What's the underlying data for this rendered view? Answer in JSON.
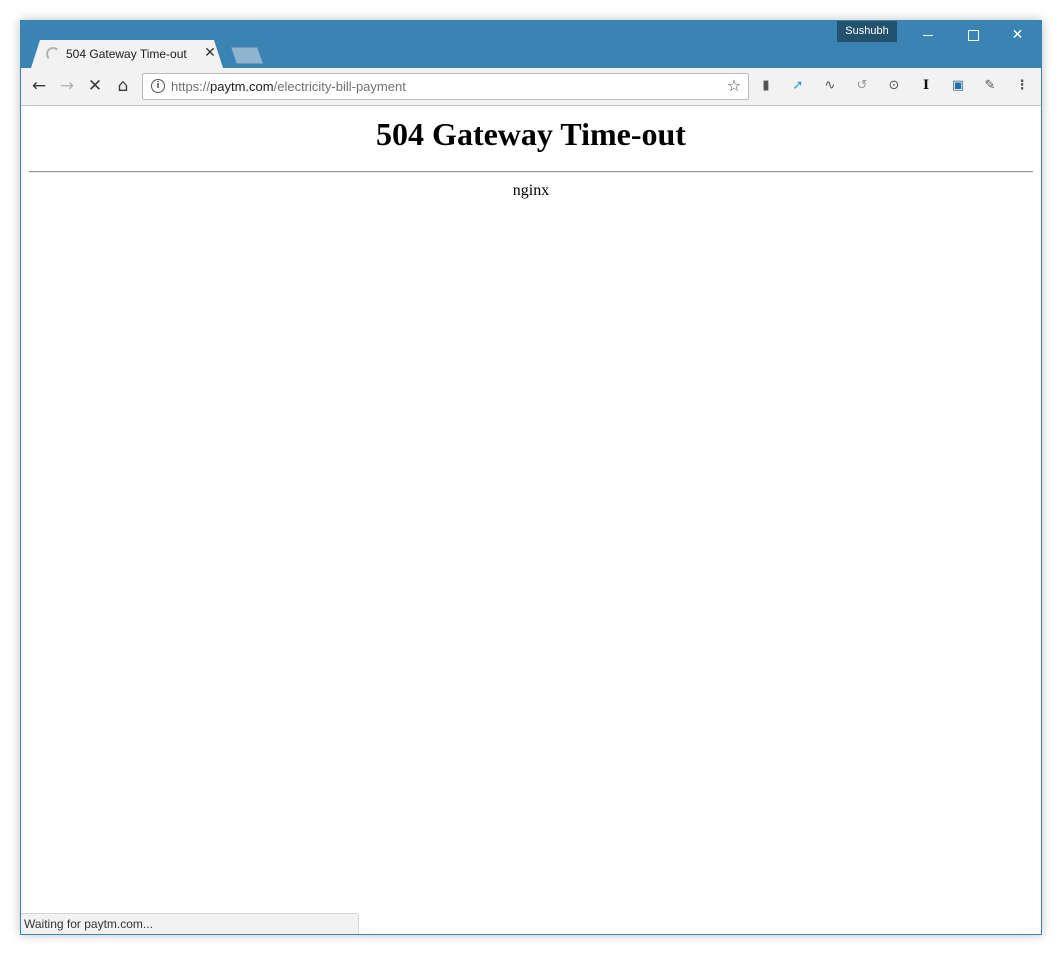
{
  "window": {
    "profile_name": "Sushubh",
    "accent_color": "#3a84b4"
  },
  "tabs": [
    {
      "title": "504 Gateway Time-out",
      "state": "loading"
    }
  ],
  "toolbar": {
    "url_scheme": "https://",
    "url_host": "paytm.com",
    "url_path": "/electricity-bill-payment",
    "extensions": [
      "bookmark-extension-icon",
      "send-arrow-extension-icon",
      "activity-pulse-extension-icon",
      "history-extension-icon",
      "password-key-extension-icon",
      "instapaper-extension-icon",
      "image-extension-icon",
      "visual-extension-icon"
    ]
  },
  "page": {
    "heading": "504 Gateway Time-out",
    "server": "nginx"
  },
  "status": {
    "text": "Waiting for paytm.com..."
  }
}
